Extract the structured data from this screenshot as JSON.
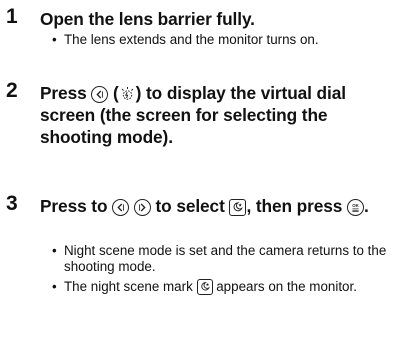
{
  "steps": [
    {
      "number": "1",
      "heading": "Open the lens barrier fully.",
      "bullets": [
        "The lens extends and the monitor turns on."
      ]
    },
    {
      "number": "2",
      "heading_parts": [
        "Press",
        "(",
        ") to display the virtual dial screen (the screen for selecting the shooting mode)."
      ],
      "icons": [
        "left-arrow-button-icon",
        "flash-icon"
      ]
    },
    {
      "number": "3",
      "heading_parts": [
        "Press to",
        "to select",
        ", then press",
        "."
      ],
      "icons": [
        "left-arrow-button-icon",
        "right-arrow-button-icon",
        "night-scene-icon",
        "ok-menu-button-icon"
      ],
      "bullets": [
        "Night scene mode is set and the camera returns to the shooting mode.",
        [
          "The night scene mark",
          "appears on the monitor."
        ]
      ]
    }
  ]
}
